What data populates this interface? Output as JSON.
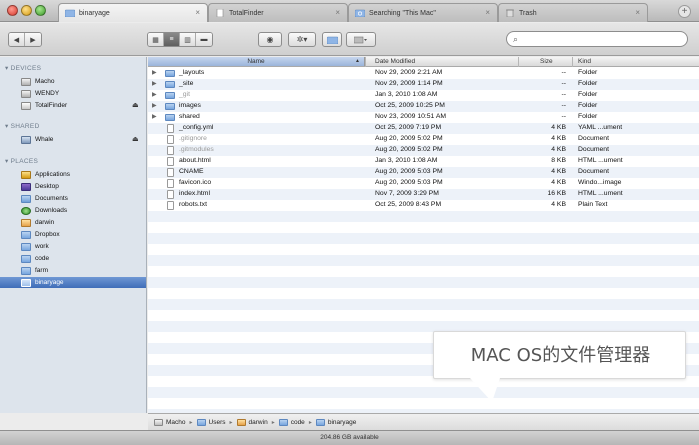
{
  "tabs": [
    {
      "label": "binaryage",
      "active": true
    },
    {
      "label": "TotalFinder",
      "active": false
    },
    {
      "label": "Searching \"This Mac\"",
      "active": false
    },
    {
      "label": "Trash",
      "active": false
    }
  ],
  "toolbar": {
    "back_icon": "back-arrow",
    "forward_icon": "forward-arrow",
    "view_modes": [
      "icon-view",
      "list-view",
      "column-view",
      "coverflow-view"
    ],
    "active_view": "list-view",
    "search_placeholder": ""
  },
  "sidebar": {
    "sections": [
      {
        "title": "DEVICES",
        "items": [
          {
            "label": "Macho",
            "icon": "hard-drive-icon"
          },
          {
            "label": "WENDY",
            "icon": "hard-drive-icon"
          },
          {
            "label": "TotalFinder",
            "icon": "drive-icon",
            "eject": true
          }
        ]
      },
      {
        "title": "SHARED",
        "items": [
          {
            "label": "Whale",
            "icon": "network-computer-icon",
            "eject": true
          }
        ]
      },
      {
        "title": "PLACES",
        "items": [
          {
            "label": "Applications",
            "icon": "applications-icon"
          },
          {
            "label": "Desktop",
            "icon": "desktop-icon"
          },
          {
            "label": "Documents",
            "icon": "documents-icon"
          },
          {
            "label": "Downloads",
            "icon": "downloads-icon"
          },
          {
            "label": "darwin",
            "icon": "home-icon"
          },
          {
            "label": "Dropbox",
            "icon": "folder-icon"
          },
          {
            "label": "work",
            "icon": "folder-icon"
          },
          {
            "label": "code",
            "icon": "folder-icon"
          },
          {
            "label": "farm",
            "icon": "folder-icon"
          },
          {
            "label": "binaryage",
            "icon": "folder-icon",
            "selected": true
          }
        ]
      }
    ]
  },
  "columns": {
    "name": "Name",
    "date": "Date Modified",
    "size": "Size",
    "kind": "Kind"
  },
  "files": [
    {
      "name": "_layouts",
      "date": "Nov 29, 2009 2:21 AM",
      "size": "--",
      "kind": "Folder",
      "type": "folder",
      "expandable": true
    },
    {
      "name": "_site",
      "date": "Nov 29, 2009 1:14 PM",
      "size": "--",
      "kind": "Folder",
      "type": "folder",
      "expandable": true
    },
    {
      "name": "_git",
      "date": "Jan 3, 2010 1:08 AM",
      "size": "--",
      "kind": "Folder",
      "type": "folder",
      "expandable": true,
      "dim": true
    },
    {
      "name": "images",
      "date": "Oct 25, 2009 10:25 PM",
      "size": "--",
      "kind": "Folder",
      "type": "folder",
      "expandable": true
    },
    {
      "name": "shared",
      "date": "Nov 23, 2009 10:51 AM",
      "size": "--",
      "kind": "Folder",
      "type": "folder",
      "expandable": true
    },
    {
      "name": "_config.yml",
      "date": "Oct 25, 2009 7:19 PM",
      "size": "4 KB",
      "kind": "YAML ...ument",
      "type": "doc"
    },
    {
      "name": ".gitignore",
      "date": "Aug 20, 2009 5:02 PM",
      "size": "4 KB",
      "kind": "Document",
      "type": "doc",
      "dim": true
    },
    {
      "name": ".gitmodules",
      "date": "Aug 20, 2009 5:02 PM",
      "size": "4 KB",
      "kind": "Document",
      "type": "doc",
      "dim": true
    },
    {
      "name": "about.html",
      "date": "Jan 3, 2010 1:08 AM",
      "size": "8 KB",
      "kind": "HTML ...ument",
      "type": "doc"
    },
    {
      "name": "CNAME",
      "date": "Aug 20, 2009 5:03 PM",
      "size": "4 KB",
      "kind": "Document",
      "type": "doc"
    },
    {
      "name": "favicon.ico",
      "date": "Aug 20, 2009 5:03 PM",
      "size": "4 KB",
      "kind": "Windo...image",
      "type": "doc"
    },
    {
      "name": "index.html",
      "date": "Nov 7, 2009 3:29 PM",
      "size": "16 KB",
      "kind": "HTML ...ument",
      "type": "doc"
    },
    {
      "name": "robots.txt",
      "date": "Oct 25, 2009 8:43 PM",
      "size": "4 KB",
      "kind": "Plain Text",
      "type": "doc"
    }
  ],
  "pathbar": [
    {
      "label": "Macho",
      "icon": "drive"
    },
    {
      "label": "Users",
      "icon": "folder"
    },
    {
      "label": "darwin",
      "icon": "home"
    },
    {
      "label": "code",
      "icon": "folder"
    },
    {
      "label": "binaryage",
      "icon": "folder"
    }
  ],
  "status": "204.86 GB available",
  "annotation": "MAC OS的文件管理器",
  "colors": {
    "selection": "#3f6db8",
    "sidebar_bg": "#dde4ec",
    "stripe": "#edf2f9"
  }
}
